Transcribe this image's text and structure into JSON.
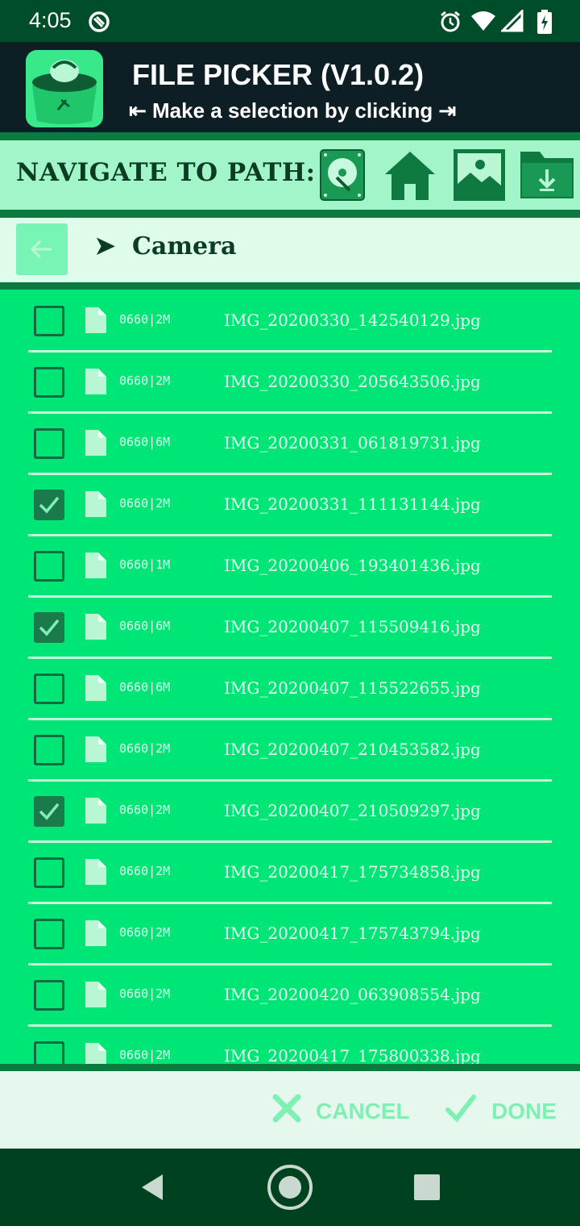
{
  "status_bar": {
    "time": "4:05",
    "icons": [
      "app-notification-icon",
      "alarm-icon",
      "wifi-icon",
      "signal-icon",
      "battery-charging-icon"
    ]
  },
  "header": {
    "title": "FILE PICKER (V1.0.2)",
    "subtitle": "⇤ Make a selection by clicking ⇥",
    "logo_icon": "app-logo-icon"
  },
  "navigation": {
    "label": "NAVIGATE TO PATH:",
    "buttons": [
      "storage-icon",
      "home-icon",
      "pictures-icon",
      "downloads-folder-icon"
    ]
  },
  "path": {
    "arrow": "➤",
    "current": "Camera"
  },
  "files": [
    {
      "meta": "0660|2M",
      "name": "IMG_20200330_142540129.jpg",
      "checked": false
    },
    {
      "meta": "0660|2M",
      "name": "IMG_20200330_205643506.jpg",
      "checked": false
    },
    {
      "meta": "0660|6M",
      "name": "IMG_20200331_061819731.jpg",
      "checked": false
    },
    {
      "meta": "0660|2M",
      "name": "IMG_20200331_111131144.jpg",
      "checked": true
    },
    {
      "meta": "0660|1M",
      "name": "IMG_20200406_193401436.jpg",
      "checked": false
    },
    {
      "meta": "0660|6M",
      "name": "IMG_20200407_115509416.jpg",
      "checked": true
    },
    {
      "meta": "0660|6M",
      "name": "IMG_20200407_115522655.jpg",
      "checked": false
    },
    {
      "meta": "0660|2M",
      "name": "IMG_20200407_210453582.jpg",
      "checked": false
    },
    {
      "meta": "0660|2M",
      "name": "IMG_20200407_210509297.jpg",
      "checked": true
    },
    {
      "meta": "0660|2M",
      "name": "IMG_20200417_175734858.jpg",
      "checked": false
    },
    {
      "meta": "0660|2M",
      "name": "IMG_20200417_175743794.jpg",
      "checked": false
    },
    {
      "meta": "0660|2M",
      "name": "IMG_20200420_063908554.jpg",
      "checked": false
    },
    {
      "meta": "0660|2M",
      "name": "IMG_20200417_175800338.jpg",
      "checked": false
    }
  ],
  "actions": {
    "cancel": "CANCEL",
    "done": "DONE"
  },
  "colors": {
    "list_bg": "#00e676",
    "header_bg": "#0d1f24",
    "accent_dark": "#0a7a3e",
    "nav_bar_bg": "#00421f"
  }
}
